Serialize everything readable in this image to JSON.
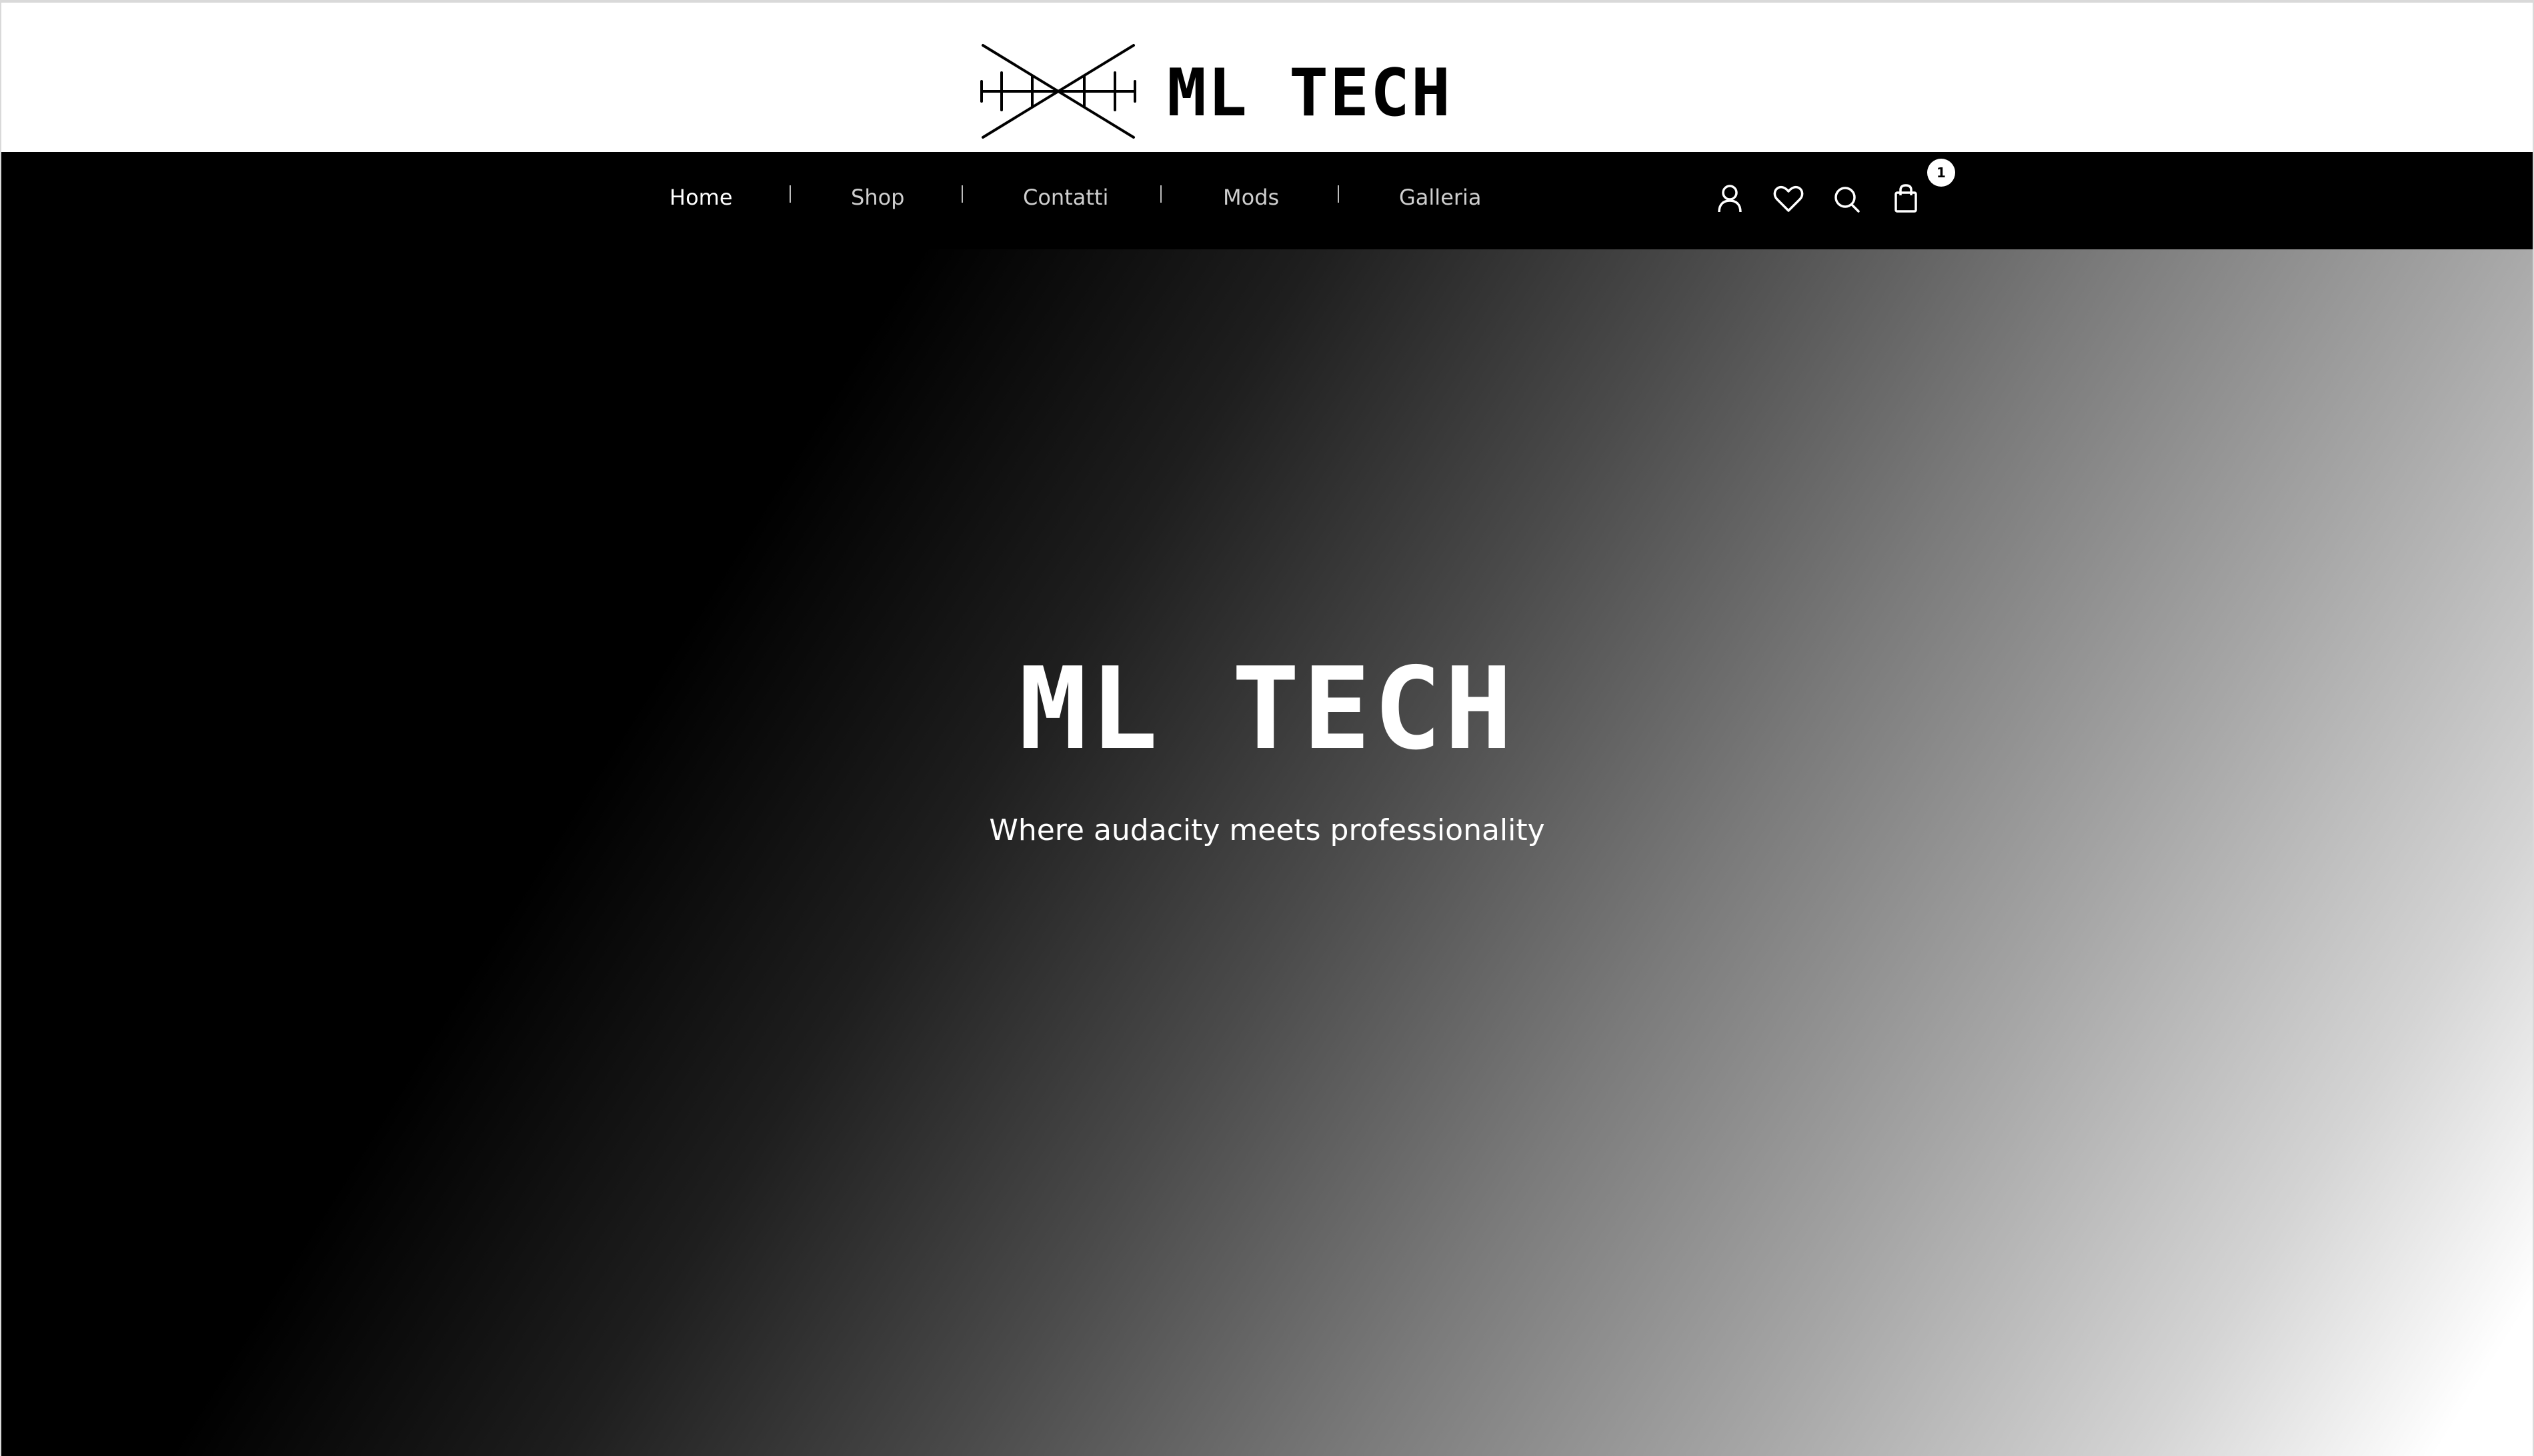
{
  "brand": {
    "name": "ML TECH",
    "logo_icon": "crossed-lines-logo-icon"
  },
  "nav": {
    "items": [
      {
        "label": "Home",
        "active": true
      },
      {
        "label": "Shop",
        "active": false
      },
      {
        "label": "Contatti",
        "active": false
      },
      {
        "label": "Mods",
        "active": false
      },
      {
        "label": "Galleria",
        "active": false
      }
    ],
    "separator": "|",
    "icons": [
      "user-icon",
      "heart-icon",
      "search-icon",
      "shopping-bag-icon"
    ],
    "cart_count": "1"
  },
  "hero": {
    "title": "ML TECH",
    "subtitle": "Where audacity meets professionality"
  },
  "colors": {
    "header_bg": "#ffffff",
    "nav_bg": "#000000",
    "text_on_dark": "#ffffff",
    "hero_gradient_start": "#000000",
    "hero_gradient_end": "#ffffff"
  }
}
